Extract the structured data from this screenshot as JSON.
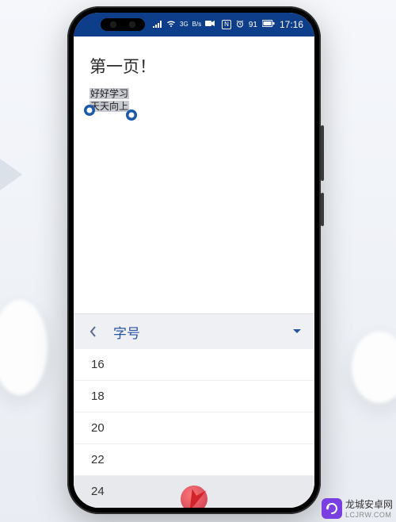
{
  "statusbar": {
    "network_label": "3G",
    "speed_label": "B/s",
    "nfc_label": "N",
    "battery_pct": "91",
    "time": "17:16"
  },
  "document": {
    "title": "第一页！",
    "selection_line1": "好好学习",
    "selection_line2": "天天向上"
  },
  "panel": {
    "title": "字号",
    "sizes": [
      "16",
      "18",
      "20",
      "22",
      "24"
    ],
    "selected_index": 4
  },
  "watermark": {
    "brand": "龙城安卓网",
    "url": "LCJRW.COM"
  }
}
